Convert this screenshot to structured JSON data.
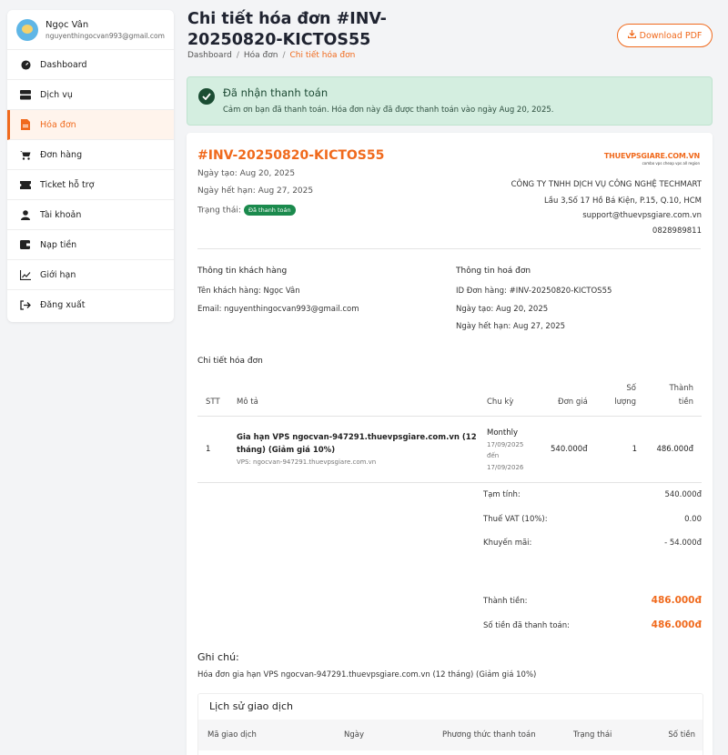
{
  "user": {
    "name": "Ngọc Vân",
    "email": "nguyenthingocvan993@gmail.com"
  },
  "sidebar": {
    "items": [
      {
        "label": "Dashboard",
        "icon": "dashboard-icon"
      },
      {
        "label": "Dịch vụ",
        "icon": "server-icon"
      },
      {
        "label": "Hóa đơn",
        "icon": "invoice-icon",
        "active": true
      },
      {
        "label": "Đơn hàng",
        "icon": "cart-icon"
      },
      {
        "label": "Ticket hỗ trợ",
        "icon": "ticket-icon"
      },
      {
        "label": "Tài khoản",
        "icon": "user-icon"
      },
      {
        "label": "Nạp tiền",
        "icon": "wallet-icon"
      },
      {
        "label": "Giới hạn",
        "icon": "chart-line-icon"
      },
      {
        "label": "Đăng xuất",
        "icon": "logout-icon"
      }
    ]
  },
  "header": {
    "title": "Chi tiết hóa đơn #INV-20250820-KICTOS55",
    "download_label": "Download PDF",
    "breadcrumb": [
      "Dashboard",
      "Hóa đơn",
      "Chi tiết hóa đơn"
    ]
  },
  "alert": {
    "title": "Đã nhận thanh toán",
    "text": "Cảm ơn bạn đã thanh toán. Hóa đơn này đã được thanh toán vào ngày Aug 20, 2025."
  },
  "invoice": {
    "number": "#INV-20250820-KICTOS55",
    "created": "Ngày tạo: Aug 20, 2025",
    "due": "Ngày hết hạn: Aug 27, 2025",
    "status_label": "Trạng thái:",
    "status": "Đã thanh toán",
    "brand_name": "THUEVPSGIARE.COM.VN",
    "brand_tagline": "combo vps cheap vps all region",
    "company_name": "CÔNG TY TNHH DỊCH VỤ CÔNG NGHỆ TECHMART",
    "company_address": "Lầu 3,Số 17 Hồ Bá Kiện, P.15, Q.10, HCM",
    "company_email": "support@thuevpsgiare.com.vn",
    "company_phone": "0828989811"
  },
  "customer": {
    "title": "Thông tin khách hàng",
    "name": "Tên khách hàng: Ngọc Vân",
    "email": "Email: nguyenthingocvan993@gmail.com"
  },
  "invoice_info": {
    "title": "Thông tin hoá đơn",
    "order_id": "ID Đơn hàng: #INV-20250820-KICTOS55",
    "created": "Ngày tạo: Aug 20, 2025",
    "due": "Ngày hết hạn: Aug 27, 2025"
  },
  "details": {
    "title": "Chi tiết hóa đơn",
    "columns": {
      "stt": "STT",
      "desc": "Mô tả",
      "cycle": "Chu kỳ",
      "price": "Đơn giá",
      "qty_1": "Số",
      "qty_2": "lượng",
      "total_1": "Thành",
      "total_2": "tiền"
    },
    "row": {
      "stt": "1",
      "desc_1": "Gia hạn VPS ngocvan-947291.thuevpsgiare.com.vn (12",
      "desc_2": "tháng) (Giảm giá 10%)",
      "sub": "VPS: ngocvan-947291.thuevpsgiare.com.vn",
      "cycle": "Monthly",
      "from": "17/09/2025",
      "to_word": "đến",
      "to": "17/09/2026",
      "price": "540.000đ",
      "qty": "1",
      "total": "486.000đ"
    },
    "summary": {
      "subtotal_label": "Tạm tính:",
      "subtotal": "540.000đ",
      "vat_label": "Thuế VAT (10%):",
      "vat": "0.00",
      "discount_label": "Khuyến mãi:",
      "discount": "- 54.000đ",
      "grand_label": "Thành tiền:",
      "grand": "486.000đ",
      "paid_label": "Số tiền đã thanh toán:",
      "paid": "486.000đ"
    }
  },
  "note": {
    "title": "Ghi chú:",
    "text": "Hóa đơn gia hạn VPS ngocvan-947291.thuevpsgiare.com.vn (12 tháng) (Giảm giá 10%)"
  },
  "history": {
    "title": "Lịch sử giao dịch",
    "columns": [
      "Mã giao dịch",
      "Ngày",
      "Phương thức thanh toán",
      "Trạng thái",
      "Số tiền"
    ]
  },
  "colors": {
    "accent": "#f06a1d",
    "success": "#1b8a4d",
    "alert_bg": "#d4eee0"
  }
}
